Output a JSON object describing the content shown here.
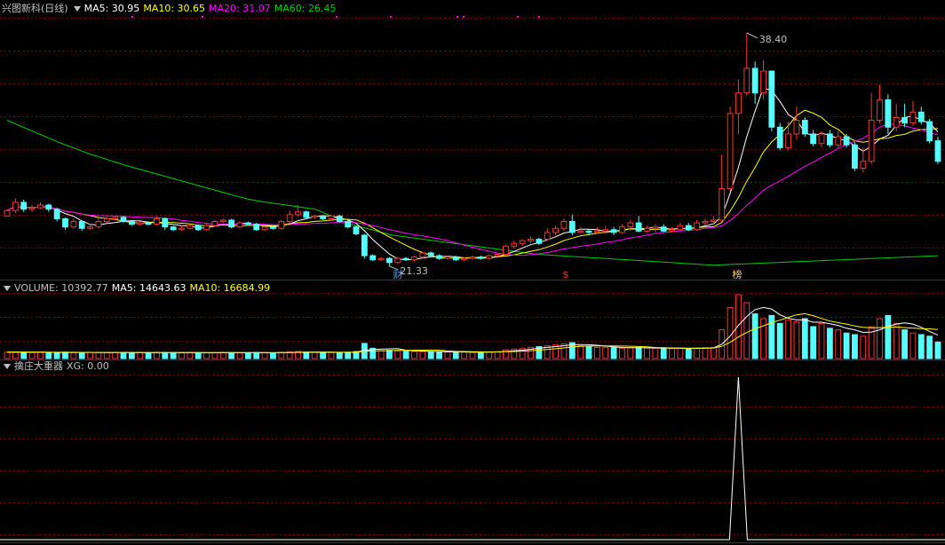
{
  "colors": {
    "background": "#000000",
    "up": "#ff3232",
    "down": "#54ffff",
    "ma5": "#ffffff",
    "ma10": "#ffff00",
    "ma20": "#ff00ff",
    "ma60": "#00cc00",
    "volume_up": "#ff3232",
    "volume_down": "#54ffff",
    "grid": "#7a0000",
    "divider": "#b00000"
  },
  "price_panel": {
    "title": "兴图新科",
    "period": "(日线)",
    "indicators": [
      {
        "label": "MA5: 30.95",
        "color": "#ffffff"
      },
      {
        "label": "MA10: 30.65",
        "color": "#ffff00"
      },
      {
        "label": "MA20: 31.07",
        "color": "#ff00ff"
      },
      {
        "label": "MA60: 26.45",
        "color": "#00cc00"
      }
    ],
    "high_label": "38.40",
    "low_label": "21.33",
    "markers": [
      {
        "label": "财",
        "color": "#4da3ff"
      },
      {
        "label": "$",
        "color": "#ff3232"
      },
      {
        "label": "榜",
        "color": "#ffcc66"
      }
    ]
  },
  "volume_panel": {
    "title": "VOLUME: 10392.77",
    "indicators": [
      {
        "label": "MA5: 14643.63",
        "color": "#ffffff"
      },
      {
        "label": "MA10: 16684.99",
        "color": "#ffff00"
      }
    ]
  },
  "indicator_panel": {
    "title": "擒庄大重器",
    "value": "XG: 0.00"
  },
  "chart_data": {
    "type": "candlestick",
    "price_range": [
      21.0,
      39.5
    ],
    "high": 38.4,
    "low": 21.33,
    "candles": [
      [
        25.0,
        25.4,
        25.0,
        25.5
      ],
      [
        25.4,
        26.0,
        25.2,
        26.3
      ],
      [
        26.0,
        25.5,
        25.3,
        26.2
      ],
      [
        25.5,
        25.6,
        25.3,
        25.8
      ],
      [
        25.6,
        25.8,
        25.5,
        26.0
      ],
      [
        25.8,
        25.5,
        25.3,
        25.9
      ],
      [
        25.5,
        24.8,
        24.6,
        25.6
      ],
      [
        24.8,
        24.2,
        24.0,
        24.9
      ],
      [
        24.2,
        24.6,
        24.1,
        24.8
      ],
      [
        24.6,
        24.1,
        23.9,
        24.7
      ],
      [
        24.1,
        24.2,
        24.0,
        24.4
      ],
      [
        24.2,
        24.6,
        24.1,
        24.8
      ],
      [
        24.6,
        24.8,
        24.5,
        24.9
      ],
      [
        24.8,
        24.9,
        24.7,
        25.0
      ],
      [
        24.9,
        24.6,
        24.5,
        25.0
      ],
      [
        24.6,
        24.4,
        24.3,
        24.7
      ],
      [
        24.4,
        24.5,
        24.3,
        24.6
      ],
      [
        24.5,
        24.4,
        24.3,
        24.6
      ],
      [
        24.4,
        24.8,
        24.3,
        25.0
      ],
      [
        24.8,
        24.2,
        24.0,
        24.9
      ],
      [
        24.2,
        24.0,
        23.9,
        24.3
      ],
      [
        24.0,
        24.1,
        23.9,
        24.3
      ],
      [
        24.1,
        24.3,
        24.0,
        24.4
      ],
      [
        24.3,
        24.0,
        23.9,
        24.4
      ],
      [
        24.0,
        24.3,
        23.9,
        24.5
      ],
      [
        24.3,
        24.6,
        24.2,
        24.7
      ],
      [
        24.6,
        24.7,
        24.5,
        24.8
      ],
      [
        24.7,
        24.2,
        24.1,
        24.8
      ],
      [
        24.2,
        24.5,
        24.1,
        24.6
      ],
      [
        24.5,
        24.4,
        24.3,
        24.6
      ],
      [
        24.4,
        24.0,
        23.9,
        24.5
      ],
      [
        24.0,
        24.2,
        23.9,
        24.3
      ],
      [
        24.2,
        24.1,
        24.0,
        24.3
      ],
      [
        24.1,
        24.6,
        24.0,
        24.7
      ],
      [
        24.6,
        25.1,
        24.5,
        25.4
      ],
      [
        25.1,
        25.3,
        25.0,
        25.8
      ],
      [
        25.3,
        24.9,
        24.8,
        25.4
      ],
      [
        24.9,
        25.0,
        24.8,
        25.1
      ],
      [
        25.0,
        24.8,
        24.7,
        25.1
      ],
      [
        24.8,
        25.0,
        24.7,
        25.1
      ],
      [
        25.0,
        24.6,
        24.5,
        25.1
      ],
      [
        24.6,
        24.2,
        24.1,
        24.7
      ],
      [
        24.2,
        23.7,
        23.6,
        24.3
      ],
      [
        23.6,
        22.1,
        21.9,
        23.7
      ],
      [
        22.1,
        21.8,
        21.7,
        22.2
      ],
      [
        21.8,
        21.9,
        21.7,
        22.0
      ],
      [
        21.9,
        21.6,
        21.33,
        22.0
      ],
      [
        21.6,
        21.9,
        21.5,
        22.0
      ],
      [
        21.9,
        21.8,
        21.7,
        22.0
      ],
      [
        21.8,
        22.0,
        21.7,
        22.1
      ],
      [
        22.0,
        22.3,
        21.9,
        22.4
      ],
      [
        22.3,
        22.1,
        22.0,
        22.4
      ],
      [
        22.1,
        21.9,
        21.8,
        22.2
      ],
      [
        21.9,
        22.0,
        21.8,
        22.1
      ],
      [
        22.0,
        21.8,
        21.7,
        22.1
      ],
      [
        21.8,
        21.9,
        21.7,
        22.0
      ],
      [
        21.9,
        22.0,
        21.8,
        22.1
      ],
      [
        22.0,
        21.9,
        21.8,
        22.1
      ],
      [
        21.9,
        22.1,
        21.8,
        22.2
      ],
      [
        22.1,
        22.2,
        22.0,
        22.3
      ],
      [
        22.2,
        22.8,
        22.1,
        22.9
      ],
      [
        22.8,
        23.0,
        22.6,
        23.2
      ],
      [
        23.0,
        23.2,
        22.8,
        23.3
      ],
      [
        23.2,
        23.3,
        23.0,
        23.5
      ],
      [
        23.3,
        23.0,
        22.9,
        23.4
      ],
      [
        23.3,
        23.8,
        23.2,
        24.1
      ],
      [
        23.8,
        24.1,
        23.6,
        24.3
      ],
      [
        24.1,
        24.6,
        23.9,
        24.8
      ],
      [
        24.6,
        23.8,
        23.6,
        25.1
      ],
      [
        23.8,
        23.9,
        23.7,
        24.2
      ],
      [
        23.9,
        23.8,
        23.6,
        24.0
      ],
      [
        23.8,
        23.9,
        23.7,
        24.2
      ],
      [
        23.9,
        24.0,
        23.7,
        24.3
      ],
      [
        24.0,
        23.8,
        23.6,
        24.2
      ],
      [
        23.8,
        24.2,
        23.7,
        24.4
      ],
      [
        24.2,
        24.5,
        23.9,
        24.7
      ],
      [
        24.5,
        23.9,
        23.8,
        25.0
      ],
      [
        23.9,
        24.1,
        23.8,
        24.3
      ],
      [
        24.1,
        24.2,
        23.8,
        24.4
      ],
      [
        24.2,
        23.9,
        23.8,
        24.4
      ],
      [
        23.9,
        24.0,
        23.8,
        24.2
      ],
      [
        24.0,
        24.3,
        23.9,
        24.5
      ],
      [
        24.3,
        24.0,
        23.9,
        24.5
      ],
      [
        24.0,
        24.5,
        23.9,
        24.7
      ],
      [
        24.5,
        24.6,
        24.3,
        24.8
      ],
      [
        24.6,
        24.7,
        24.4,
        25.0
      ],
      [
        24.7,
        27.0,
        24.6,
        29.5
      ],
      [
        27.0,
        32.5,
        26.8,
        33.0
      ],
      [
        32.5,
        34.0,
        31.0,
        35.0
      ],
      [
        34.0,
        35.8,
        33.8,
        38.4
      ],
      [
        35.8,
        34.0,
        33.2,
        36.3
      ],
      [
        34.0,
        35.6,
        33.5,
        36.4
      ],
      [
        35.6,
        31.5,
        31.2,
        35.6
      ],
      [
        31.5,
        30.0,
        29.8,
        31.8
      ],
      [
        30.0,
        31.0,
        29.8,
        31.9
      ],
      [
        31.0,
        32.0,
        30.6,
        33.0
      ],
      [
        32.0,
        31.0,
        30.8,
        32.2
      ],
      [
        31.0,
        30.3,
        30.1,
        31.3
      ],
      [
        30.3,
        31.0,
        30.0,
        31.2
      ],
      [
        31.0,
        30.2,
        30.0,
        31.3
      ],
      [
        30.2,
        30.8,
        30.0,
        31.2
      ],
      [
        30.8,
        30.2,
        30.0,
        31.0
      ],
      [
        30.2,
        28.5,
        28.3,
        30.4
      ],
      [
        28.5,
        29.0,
        28.2,
        30.0
      ],
      [
        29.0,
        32.0,
        28.8,
        34.0
      ],
      [
        32.0,
        33.5,
        31.8,
        34.6
      ],
      [
        33.5,
        31.5,
        31.0,
        33.9
      ],
      [
        31.5,
        32.2,
        31.2,
        33.2
      ],
      [
        32.2,
        31.8,
        31.5,
        33.2
      ],
      [
        31.8,
        32.6,
        31.6,
        33.4
      ],
      [
        32.6,
        31.9,
        31.7,
        33.0
      ],
      [
        31.9,
        30.5,
        30.3,
        32.1
      ],
      [
        30.5,
        29.0,
        28.8,
        30.8
      ]
    ],
    "volume": [
      4000,
      4200,
      4000,
      3800,
      3900,
      3700,
      3900,
      4000,
      3800,
      3700,
      3900,
      3800,
      3700,
      3900,
      3800,
      3700,
      3800,
      3700,
      3900,
      3800,
      3700,
      3600,
      3800,
      3700,
      3600,
      3700,
      3800,
      3700,
      3600,
      3700,
      3800,
      3700,
      3600,
      3800,
      4200,
      4500,
      4100,
      3900,
      3800,
      3800,
      3900,
      4000,
      4400,
      9500,
      6500,
      5000,
      5200,
      4800,
      4600,
      4500,
      4400,
      4300,
      4200,
      4100,
      4000,
      4100,
      4000,
      4100,
      4200,
      4300,
      5500,
      6000,
      6500,
      7000,
      7500,
      8000,
      8500,
      9200,
      10000,
      8000,
      7500,
      7000,
      7000,
      6800,
      6500,
      6800,
      7000,
      6600,
      6500,
      6200,
      6300,
      6500,
      6400,
      6600,
      6800,
      7000,
      18000,
      32000,
      40000,
      35000,
      28000,
      25000,
      27000,
      22000,
      24000,
      23000,
      25000,
      20000,
      22000,
      19000,
      18000,
      16000,
      15000,
      14000,
      20000,
      25000,
      27000,
      22000,
      18000,
      16000,
      15000,
      14000,
      10392.77
    ],
    "ma60": [
      [
        0,
        32.0
      ],
      [
        16,
        30.4
      ],
      [
        25,
        29.6
      ],
      [
        37,
        28.7
      ],
      [
        60,
        27.2
      ],
      [
        74,
        26.3
      ],
      [
        78,
        26.1
      ],
      [
        96,
        25.5
      ],
      [
        107,
        24.4
      ],
      [
        120,
        23.6
      ],
      [
        165,
        22.2
      ],
      [
        186,
        21.9
      ],
      [
        220,
        21.4
      ],
      [
        250,
        21.7
      ],
      [
        290,
        22.1
      ]
    ],
    "xg_spike_index": 88,
    "xg_peak": 1.0
  }
}
